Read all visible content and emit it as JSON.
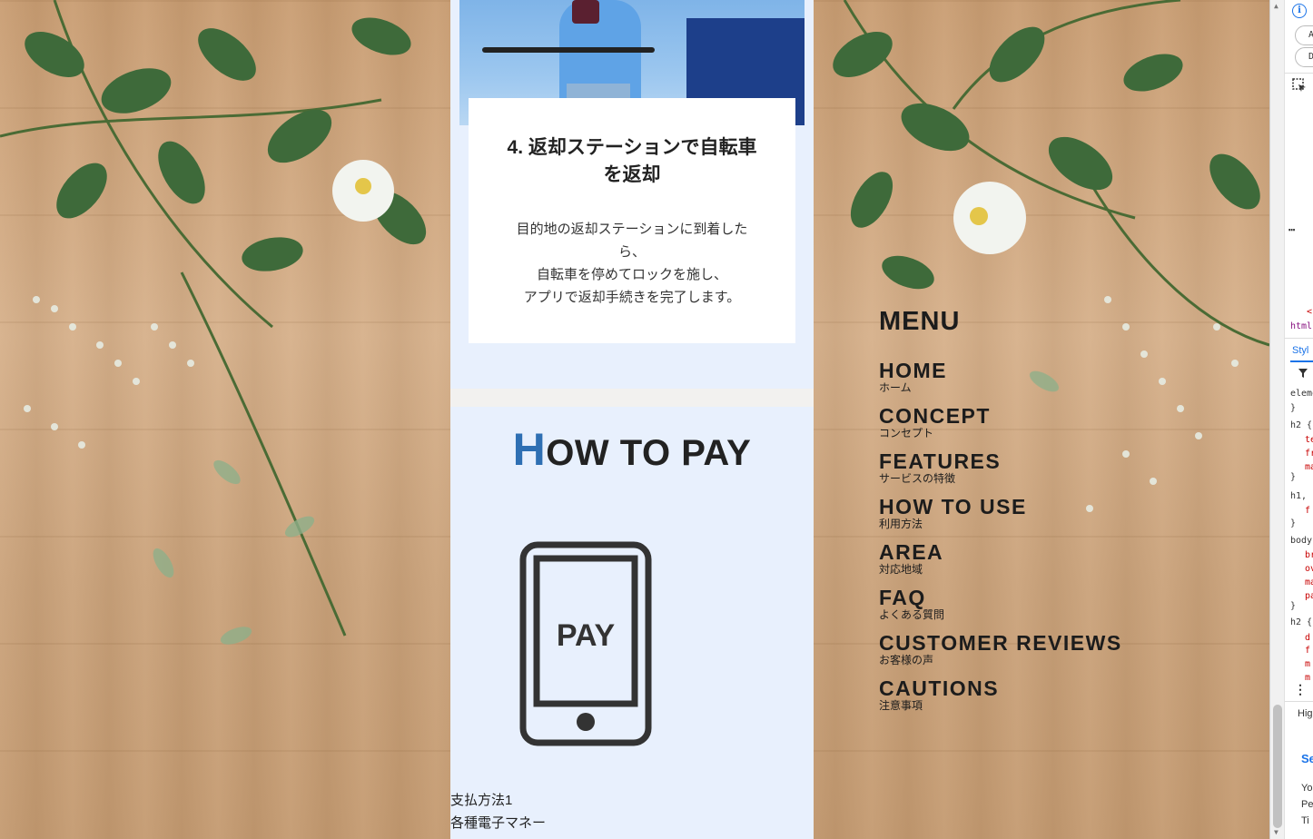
{
  "step_card": {
    "title": "4. 返却ステーションで自転車を返却",
    "text_lines": [
      "目的地の返却ステーションに到着したら、",
      "自転車を停めてロックを施し、",
      "アプリで返却手続きを完了します。"
    ]
  },
  "how_to_pay": {
    "heading_first": "H",
    "heading_rest": "OW TO PAY",
    "icon": "smartphone-pay-icon",
    "icon_label": "PAY",
    "method_label": "支払方法1",
    "method_value": "各種電子マネー"
  },
  "menu": {
    "title": "MENU",
    "items": [
      {
        "en": "HOME",
        "jp": "ホーム"
      },
      {
        "en": "CONCEPT",
        "jp": "コンセプト"
      },
      {
        "en": "FEATURES",
        "jp": "サービスの特徴"
      },
      {
        "en": "HOW TO USE",
        "jp": "利用方法"
      },
      {
        "en": "AREA",
        "jp": "対応地域"
      },
      {
        "en": "FAQ",
        "jp": "よくある質問"
      },
      {
        "en": "CUSTOMER REVIEWS",
        "jp": "お客様の声"
      },
      {
        "en": "CAUTIONS",
        "jp": "注意事項"
      }
    ]
  },
  "devtools": {
    "pill_a": "A",
    "pill_d": "D",
    "html_tab": "html",
    "styles_tab": "Styl",
    "code_lines": [
      {
        "text": "eleme",
        "cls": ""
      },
      {
        "text": "}",
        "cls": ""
      },
      {
        "text": "h2 {",
        "cls": ""
      },
      {
        "text": "te",
        "cls": "red"
      },
      {
        "text": "fr",
        "cls": "red"
      },
      {
        "text": "ma",
        "cls": "red"
      },
      {
        "text": "}",
        "cls": ""
      },
      {
        "text": "h1, h",
        "cls": ""
      },
      {
        "text": "f",
        "cls": "red"
      },
      {
        "text": "}",
        "cls": ""
      },
      {
        "text": "body",
        "cls": ""
      },
      {
        "text": "br",
        "cls": "red"
      },
      {
        "text": "ov",
        "cls": "red"
      },
      {
        "text": "ma",
        "cls": "red"
      },
      {
        "text": "pa",
        "cls": "red"
      },
      {
        "text": "}",
        "cls": ""
      },
      {
        "text": "h2 {",
        "cls": ""
      },
      {
        "text": "d",
        "cls": "red"
      },
      {
        "text": "f",
        "cls": "red"
      },
      {
        "text": "m",
        "cls": "red"
      },
      {
        "text": "m",
        "cls": "red"
      }
    ],
    "highlight_label": "Hig",
    "section_label": "Se",
    "bottom_lines": [
      "Yo",
      "Pe",
      "Ti"
    ]
  },
  "colors": {
    "accent_blue": "#2e6fb3",
    "column_bg": "#e8f0fd",
    "text_dark": "#1c1c1c",
    "devtools_blue": "#1a73e8"
  }
}
